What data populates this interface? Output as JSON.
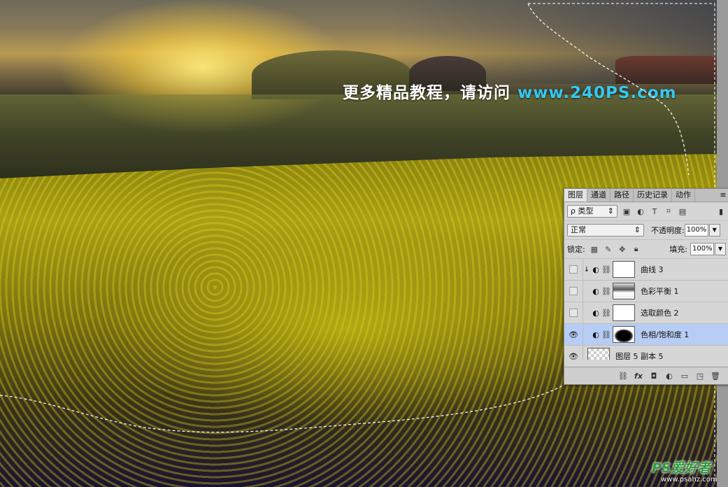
{
  "watermark": {
    "text": "更多精品教程，请访问",
    "url": "www.240PS.com"
  },
  "panel": {
    "tabs": [
      "图层",
      "通道",
      "路径",
      "历史记录",
      "动作"
    ],
    "menu_icon": "panel-menu-icon",
    "filter": {
      "kind": "ρ 类型",
      "arrow": "⇕"
    },
    "filter_icons": [
      "image-filter-icon",
      "adjustment-filter-icon",
      "type-filter-icon",
      "shape-filter-icon",
      "smart-object-filter-icon"
    ],
    "blend_mode": "正常",
    "opacity_label": "不透明度:",
    "opacity_value": "100%",
    "lock_label": "锁定:",
    "lock_icons": [
      "lock-transparent-icon",
      "lock-image-icon",
      "lock-position-icon",
      "lock-all-icon"
    ],
    "fill_label": "填充:",
    "fill_value": "100%",
    "layers": [
      {
        "name": "曲线 3",
        "visible": false,
        "clipped": true,
        "thumb": "white",
        "selected": false
      },
      {
        "name": "色彩平衡 1",
        "visible": false,
        "clipped": false,
        "thumb": "mask",
        "selected": false
      },
      {
        "name": "选取颜色 2",
        "visible": false,
        "clipped": false,
        "thumb": "white",
        "selected": false
      },
      {
        "name": "色相/饱和度 1",
        "visible": true,
        "clipped": false,
        "thumb": "dark-mask",
        "selected": true
      },
      {
        "name": "图层 5 副本 5",
        "visible": true,
        "clipped": false,
        "thumb": "transparent",
        "selected": false
      }
    ],
    "bottom_icons": [
      "link-layers-icon",
      "fx-icon",
      "add-mask-icon",
      "new-adjustment-icon",
      "new-group-icon",
      "new-layer-icon"
    ]
  },
  "corner": {
    "logo": "PS爱好者",
    "url": "www.psahz.com"
  },
  "colors": {
    "watermark_url": "#35c8f0",
    "selected_layer": "#b7cdf5",
    "logo": "#2a9a3a"
  }
}
